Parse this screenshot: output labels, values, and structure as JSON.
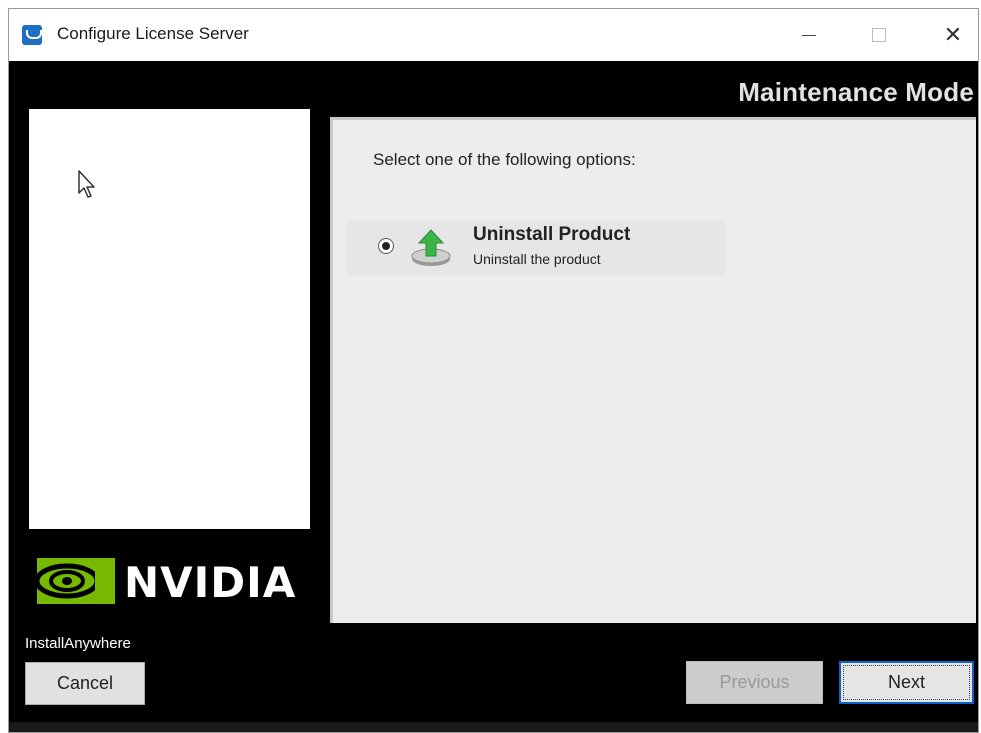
{
  "window": {
    "title": "Configure License Server",
    "minimize_icon": "minimize-icon",
    "maximize_icon": "maximize-icon",
    "close_symbol": "✕"
  },
  "header": {
    "mode_title": "Maintenance Mode"
  },
  "branding": {
    "logo_text": "NVIDIA",
    "installer_label": "InstallAnywhere",
    "brand_color": "#76b900"
  },
  "content": {
    "prompt": "Select one of the following options:",
    "options": [
      {
        "title": "Uninstall Product",
        "description": "Uninstall the product",
        "selected": true,
        "icon": "uninstall-arrow-icon"
      }
    ]
  },
  "footer": {
    "cancel_label": "Cancel",
    "previous_label": "Previous",
    "next_label": "Next",
    "previous_enabled": false,
    "focus_color": "#0a64c8"
  }
}
